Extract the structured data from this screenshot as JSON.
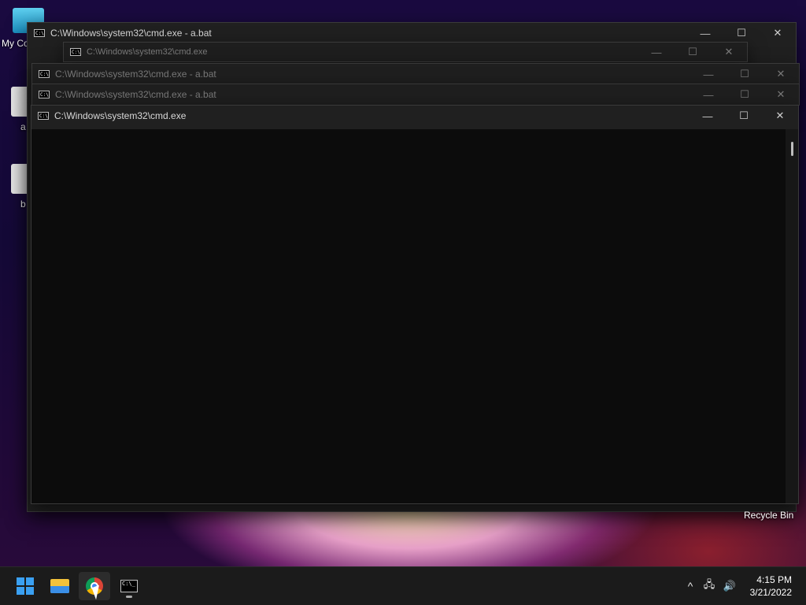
{
  "desktop": {
    "icons": [
      {
        "label": "My Co"
      },
      {
        "label": "a"
      },
      {
        "label": "b"
      }
    ],
    "recycle_bin": "Recycle Bin"
  },
  "windows": [
    {
      "title": "C:\\Windows\\system32\\cmd.exe - a.bat",
      "state": "background"
    },
    {
      "title": "C:\\Windows\\system32\\cmd.exe",
      "state": "dim"
    },
    {
      "title": "C:\\Windows\\system32\\cmd.exe - a.bat",
      "state": "dim"
    },
    {
      "title": "C:\\Windows\\system32\\cmd.exe - a.bat",
      "state": "dim"
    },
    {
      "title": "C:\\Windows\\system32\\cmd.exe",
      "state": "active"
    }
  ],
  "window_controls": {
    "minimize": "—",
    "maximize": "☐",
    "close": "✕"
  },
  "taskbar": {
    "apps": [
      {
        "name": "start",
        "icon": "windows-start-icon"
      },
      {
        "name": "file-explorer",
        "icon": "folder-icon"
      },
      {
        "name": "chrome",
        "icon": "chrome-icon"
      },
      {
        "name": "command-prompt",
        "icon": "cmd-icon"
      }
    ],
    "tray": {
      "chevron": "^",
      "network": "🖧",
      "volume": "🔊"
    },
    "clock": {
      "time": "4:15 PM",
      "date": "3/21/2022"
    }
  },
  "colors": {
    "accent": "#3aa0f2",
    "console_bg": "#0c0c0c",
    "title_bg": "#202020"
  }
}
